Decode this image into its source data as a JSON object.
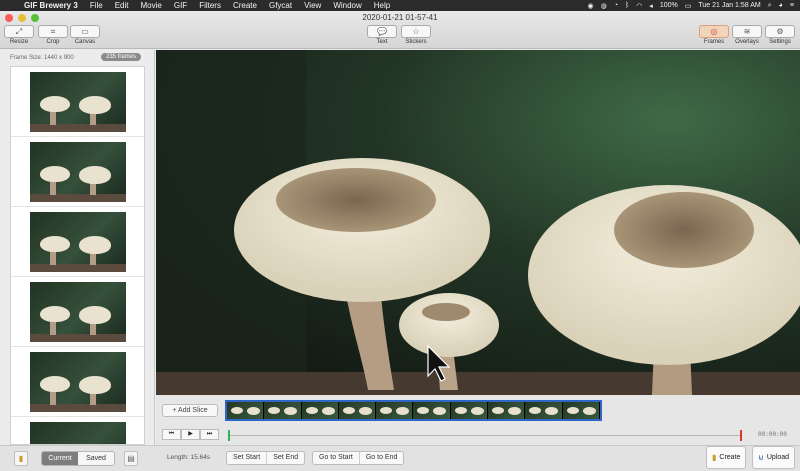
{
  "menubar": {
    "app_name": "GIF Brewery 3",
    "items": [
      "File",
      "Edit",
      "Movie",
      "GIF",
      "Filters",
      "Create",
      "Gfycat",
      "View",
      "Window",
      "Help"
    ],
    "battery": "100%",
    "datetime": "Tue 21 Jan  1:58 AM"
  },
  "window": {
    "title": "2020-01-21 01-57-41"
  },
  "toolbar": {
    "left": [
      {
        "label": "Resize",
        "icon": "resize-icon",
        "glyph": "⤢"
      },
      {
        "label": "Crop",
        "icon": "crop-icon",
        "glyph": "⌗"
      },
      {
        "label": "Canvas",
        "icon": "canvas-icon",
        "glyph": "▭"
      }
    ],
    "center": [
      {
        "label": "Text",
        "icon": "speech-bubble-icon",
        "glyph": "💬"
      },
      {
        "label": "Stickers",
        "icon": "star-icon",
        "glyph": "☆"
      }
    ],
    "right": [
      {
        "label": "Frames",
        "icon": "frames-icon",
        "glyph": "◎",
        "active": true
      },
      {
        "label": "Overlays",
        "icon": "layers-icon",
        "glyph": "≋"
      },
      {
        "label": "Settings",
        "icon": "gear-icon",
        "glyph": "⚙"
      }
    ]
  },
  "sidebar": {
    "frame_size": "Frame Size: 1440 x 900",
    "frame_count": "235 frames",
    "visible_frames": 6
  },
  "timeline": {
    "add_slice": "+ Add Slice",
    "timecode": "00:00:00",
    "strip_cells": 10,
    "controls": [
      "⏮",
      "▶",
      "⏭"
    ]
  },
  "bottombar": {
    "tabs": [
      {
        "label": "Current",
        "selected": true
      },
      {
        "label": "Saved",
        "selected": false
      }
    ],
    "length": "Length: 15.64s",
    "set_start": "Set Start",
    "set_end": "Set End",
    "go_to_start": "Go to Start",
    "go_to_end": "Go to End",
    "create": "Create",
    "upload": "Upload"
  },
  "colors": {
    "accent_active": "#f2d3bc",
    "strip_border": "#2d66c8",
    "start_marker": "#2fb35a",
    "end_marker": "#d83a2a"
  }
}
